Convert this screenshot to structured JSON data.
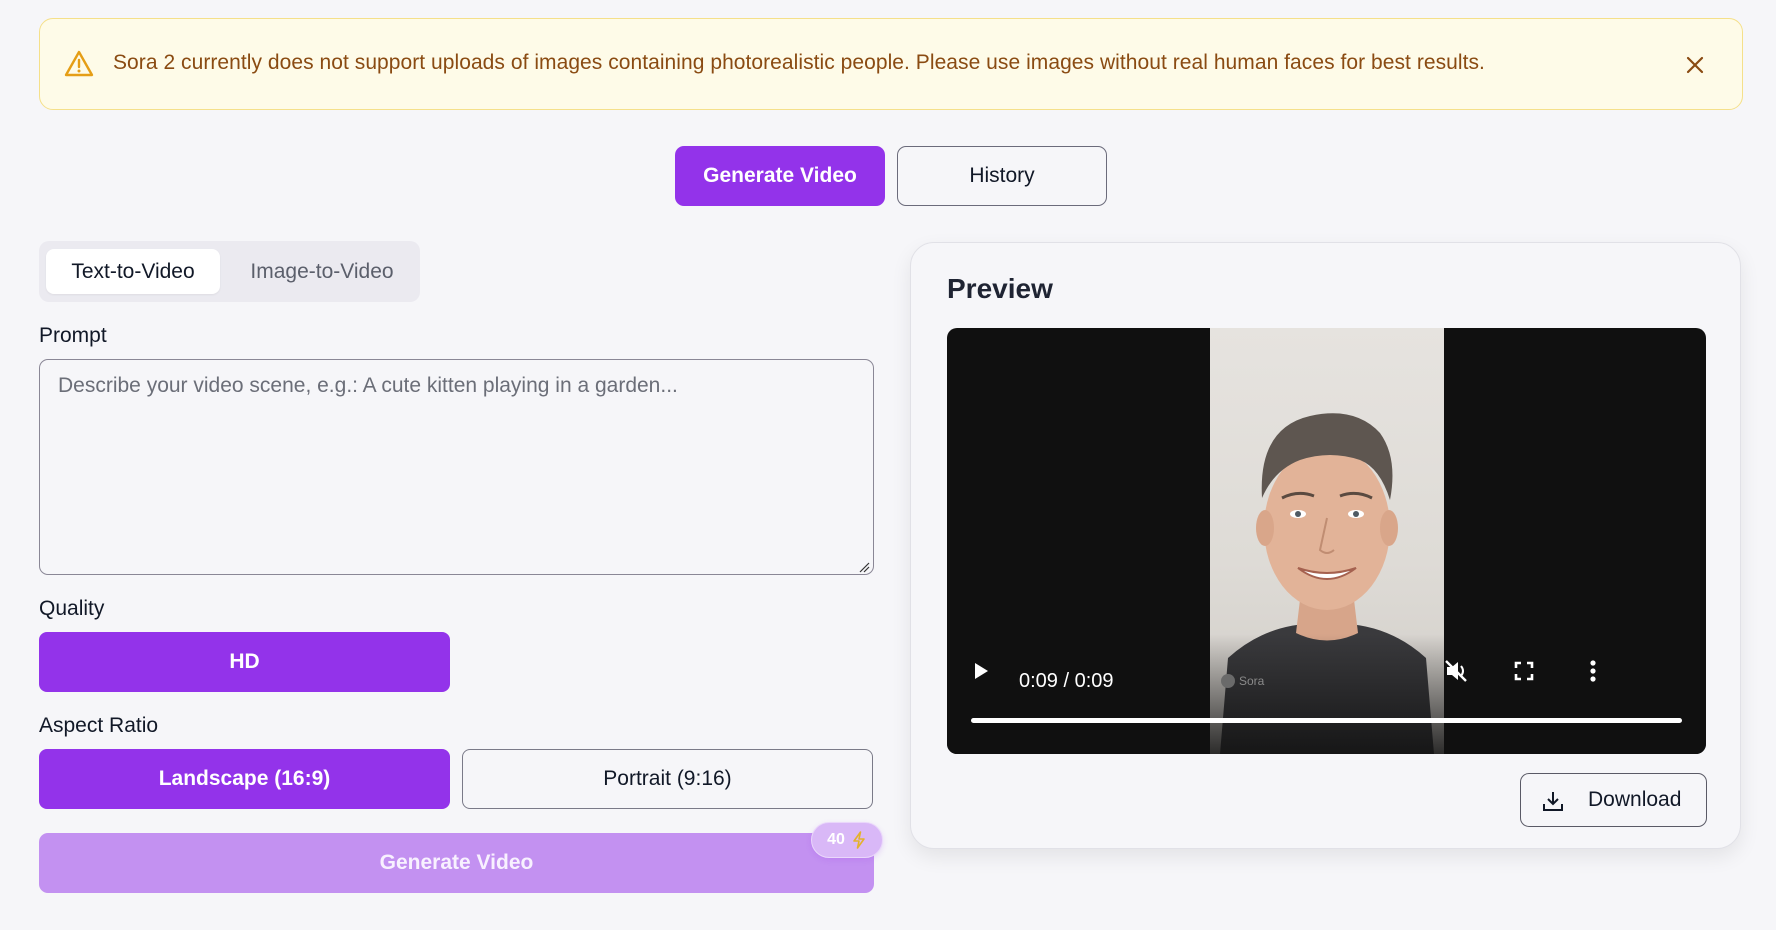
{
  "alert": {
    "message": "Sora 2 currently does not support uploads of images containing photorealistic people. Please use images without real human faces for best results.",
    "icon": "warning-triangle-icon",
    "close_icon": "close-icon"
  },
  "nav": {
    "generate_label": "Generate Video",
    "history_label": "History"
  },
  "tabs": [
    {
      "label": "Text-to-Video",
      "active": true
    },
    {
      "label": "Image-to-Video",
      "active": false
    }
  ],
  "prompt": {
    "label": "Prompt",
    "placeholder": "Describe your video scene, e.g.: A cute kitten playing in a garden...",
    "value": ""
  },
  "quality": {
    "label": "Quality",
    "options": [
      {
        "label": "HD",
        "selected": true
      }
    ]
  },
  "aspect_ratio": {
    "label": "Aspect Ratio",
    "options": [
      {
        "label": "Landscape (16:9)",
        "selected": true
      },
      {
        "label": "Portrait (9:16)",
        "selected": false
      }
    ]
  },
  "generate": {
    "label": "Generate Video",
    "credits": "40",
    "credit_icon": "lightning-icon"
  },
  "preview": {
    "title": "Preview",
    "video": {
      "time": "0:09 / 0:09",
      "progress": 1.0,
      "watermark": "Sora",
      "muted": true
    },
    "download_label": "Download"
  },
  "colors": {
    "accent": "#9333ea",
    "accent_disabled": "#c391f1",
    "alert_bg": "#fefbe8",
    "alert_text": "#8a4b12",
    "page_bg": "#f6f6f9"
  }
}
